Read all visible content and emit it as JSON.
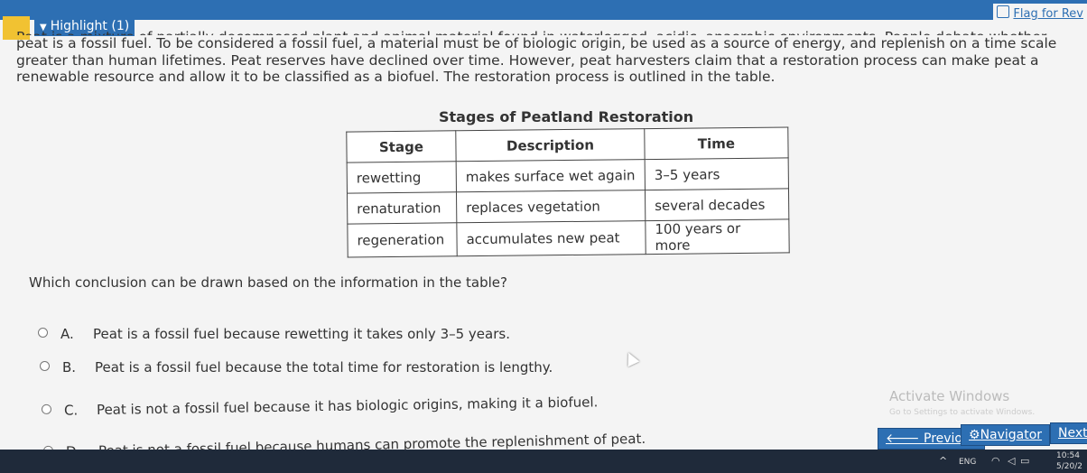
{
  "header": {
    "highlight_label": "Highlight (1)",
    "flag_label": "Flag for Rev"
  },
  "passage": {
    "line0": "Peat is a mixture of partially decomposed plant and animal material found in waterlogged, acidic, anaerobic environments. People debate whether",
    "line1": "peat is a fossil fuel. To be considered a fossil fuel, a material must be of biologic origin, be used as a source of energy, and replenish on a time scale",
    "line2": "greater than human lifetimes. Peat reserves have declined over time. However, peat harvesters claim that a restoration process can make peat a",
    "line3": "renewable resource and allow it to be classified as a biofuel. The restoration process is outlined in the table."
  },
  "table": {
    "title": "Stages of Peatland Restoration",
    "headers": [
      "Stage",
      "Description",
      "Time"
    ],
    "rows": [
      [
        "rewetting",
        "makes surface wet again",
        "3–5 years"
      ],
      [
        "renaturation",
        "replaces vegetation",
        "several decades"
      ],
      [
        "regeneration",
        "accumulates new peat",
        "100 years or more"
      ]
    ]
  },
  "question": "Which conclusion can be drawn based on the information in the table?",
  "options": [
    {
      "letter": "A.",
      "text": "Peat is a fossil fuel because rewetting it takes only 3–5 years."
    },
    {
      "letter": "B.",
      "text": "Peat is a fossil fuel because the total time for restoration is lengthy."
    },
    {
      "letter": "C.",
      "text": "Peat is not a fossil fuel because it has biologic origins, making it a biofuel."
    },
    {
      "letter": "D.",
      "text": "Peat is not a fossil fuel because humans can promote the replenishment of peat."
    }
  ],
  "watermark": {
    "title": "Activate Windows",
    "sub": "Go to Settings to activate Windows."
  },
  "nav": {
    "previous": "Previous",
    "navigator": "Navigator",
    "next": "Next"
  },
  "taskbar": {
    "lang": "ENG",
    "time": "10:54",
    "date": "5/20/2"
  },
  "colors": {
    "accent": "#2d6fb3",
    "highlight": "#f1c232"
  }
}
